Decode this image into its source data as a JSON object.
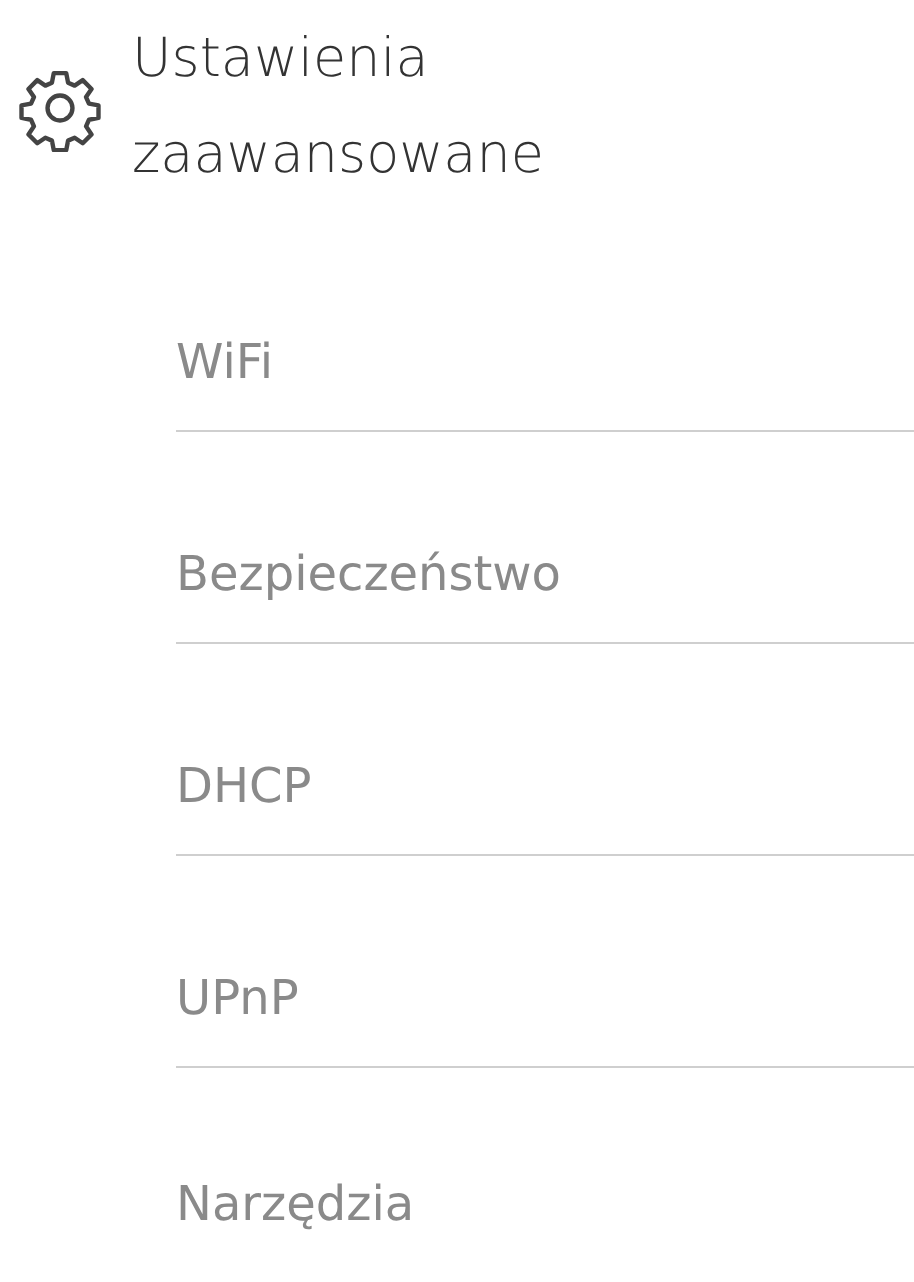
{
  "header": {
    "title": "Ustawienia zaawansowane"
  },
  "menu": [
    {
      "label": "WiFi"
    },
    {
      "label": "Bezpieczeństwo"
    },
    {
      "label": "DHCP"
    },
    {
      "label": "UPnP"
    },
    {
      "label": "Narzędzia"
    }
  ]
}
